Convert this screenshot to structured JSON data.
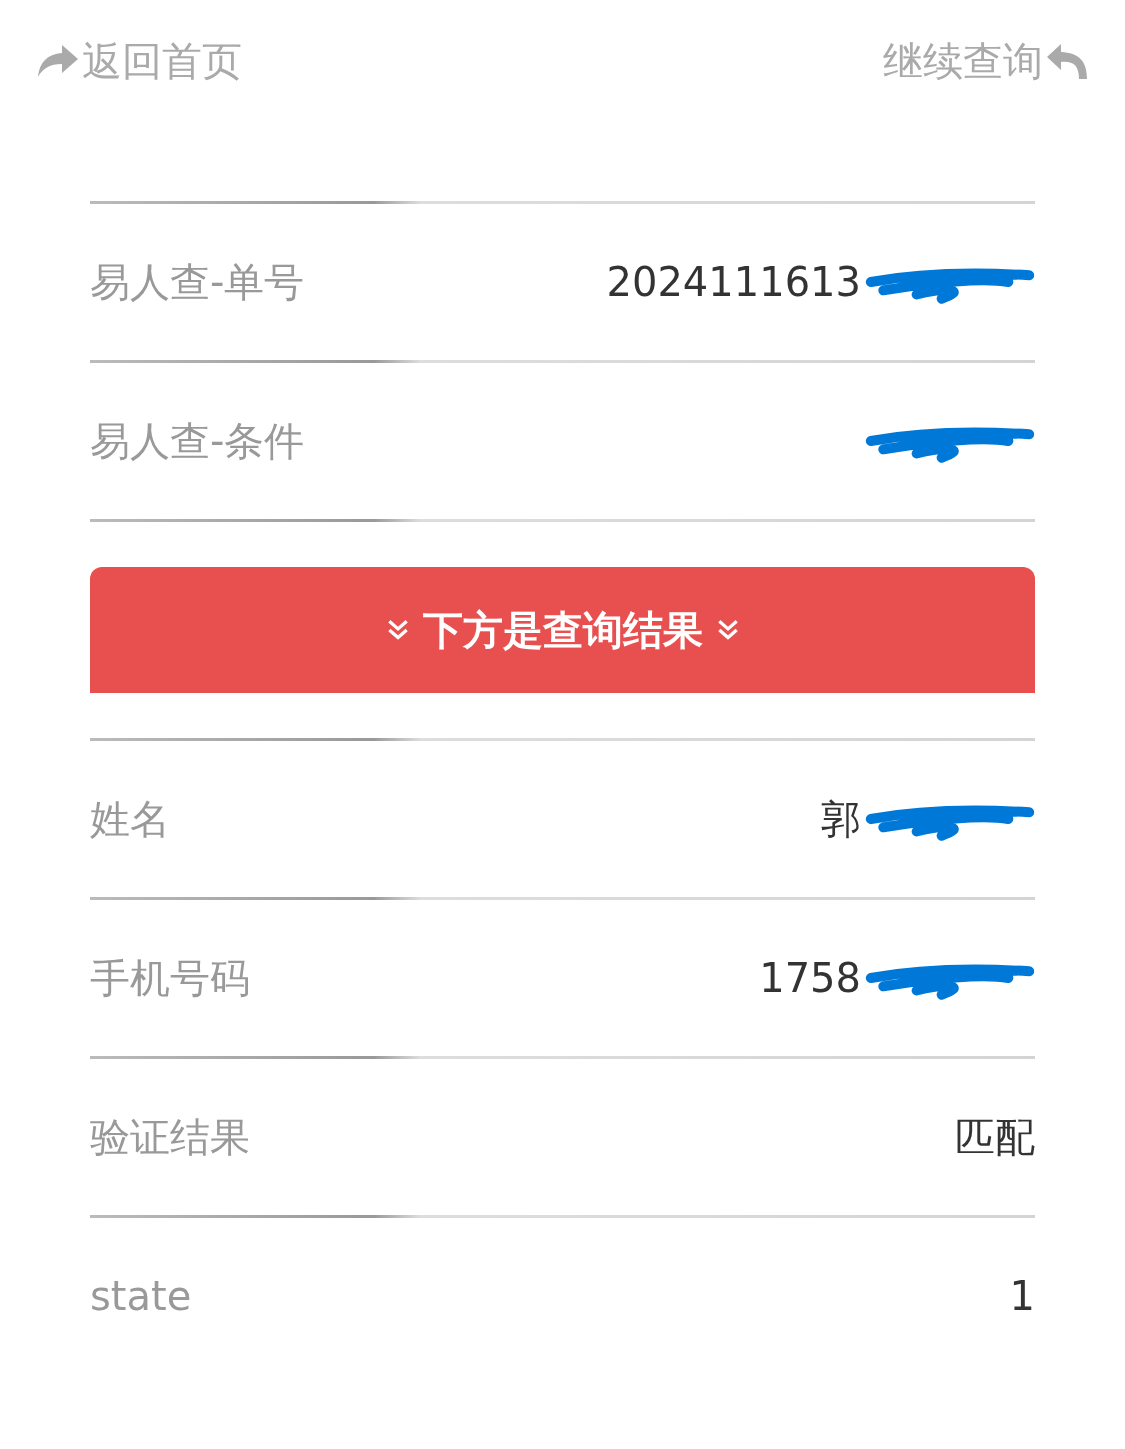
{
  "header": {
    "back": "返回首页",
    "continue": "继续查询"
  },
  "query_rows": [
    {
      "label": "易人查-单号",
      "value": "2024111613",
      "redacted": true
    },
    {
      "label": "易人查-条件",
      "value": "",
      "redacted": true
    }
  ],
  "banner": "下方是查询结果",
  "result_rows": [
    {
      "label": "姓名",
      "value": "郭",
      "redacted": true
    },
    {
      "label": "手机号码",
      "value": "1758",
      "redacted": true
    },
    {
      "label": "验证结果",
      "value": "匹配",
      "redacted": false
    },
    {
      "label": "state",
      "value": "1",
      "redacted": false
    }
  ]
}
